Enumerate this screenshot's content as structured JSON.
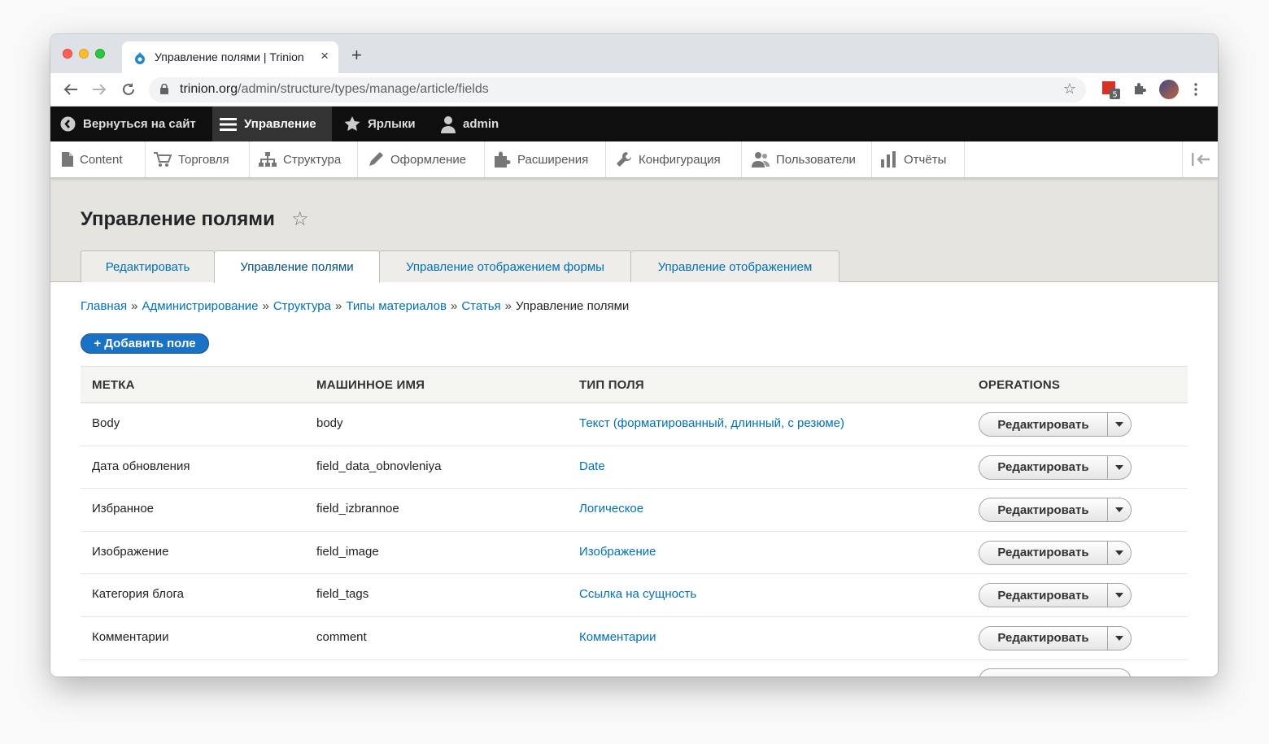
{
  "browser": {
    "tab_title": "Управление полями | Trinion",
    "new_tab": "+",
    "close": "×",
    "url_host": "trinion.org",
    "url_path": "/admin/structure/types/manage/article/fields",
    "ext_badge": "5"
  },
  "admin_toolbar": {
    "back": "Вернуться на сайт",
    "manage": "Управление",
    "shortcuts": "Ярлыки",
    "user": "admin"
  },
  "menu": [
    {
      "label": "Content",
      "icon": "file-icon"
    },
    {
      "label": "Торговля",
      "icon": "cart-icon"
    },
    {
      "label": "Структура",
      "icon": "hierarchy-icon"
    },
    {
      "label": "Оформление",
      "icon": "brush-icon"
    },
    {
      "label": "Расширения",
      "icon": "puzzle-icon"
    },
    {
      "label": "Конфигурация",
      "icon": "wrench-icon"
    },
    {
      "label": "Пользователи",
      "icon": "people-icon"
    },
    {
      "label": "Отчёты",
      "icon": "bar-chart-icon"
    }
  ],
  "page": {
    "title": "Управление полями",
    "tabs": [
      "Редактировать",
      "Управление полями",
      "Управление отображением формы",
      "Управление отображением"
    ],
    "active_tab": 1
  },
  "breadcrumb": [
    "Главная",
    "Администрирование",
    "Структура",
    "Типы материалов",
    "Статья"
  ],
  "breadcrumb_current": "Управление полями",
  "breadcrumb_sep": "»",
  "add_button": "+ Добавить поле",
  "table": {
    "headers": [
      "Метка",
      "Машинное имя",
      "Тип поля",
      "Operations"
    ],
    "rows": [
      {
        "label": "Body",
        "machine": "body",
        "type": "Текст (форматированный, длинный, с резюме)",
        "op": "Редактировать"
      },
      {
        "label": "Дата обновления",
        "machine": "field_data_obnovleniya",
        "type": "Date",
        "op": "Редактировать"
      },
      {
        "label": "Избранное",
        "machine": "field_izbrannoe",
        "type": "Логическое",
        "op": "Редактировать"
      },
      {
        "label": "Изображение",
        "machine": "field_image",
        "type": "Изображение",
        "op": "Редактировать"
      },
      {
        "label": "Категория блога",
        "machine": "field_tags",
        "type": "Ссылка на сущность",
        "op": "Редактировать"
      },
      {
        "label": "Комментарии",
        "machine": "comment",
        "type": "Комментарии",
        "op": "Редактировать"
      }
    ]
  },
  "colors": {
    "link": "#0071b8",
    "primary_button": "#1a72c5",
    "admin_bar": "#0f0f0f",
    "header_bg": "#e6e4df"
  }
}
